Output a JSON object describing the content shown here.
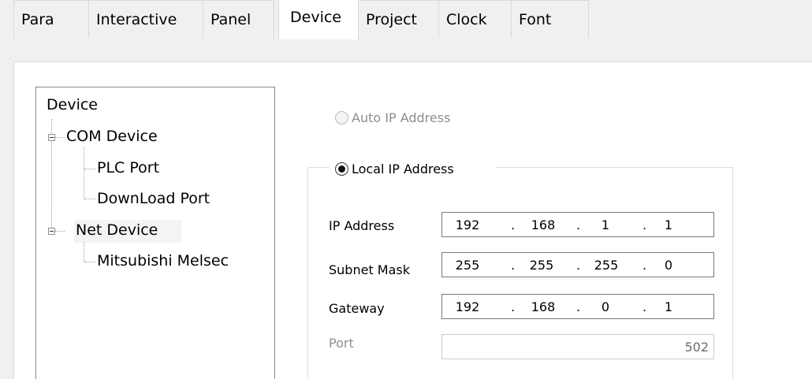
{
  "tabs": [
    {
      "label": "Para"
    },
    {
      "label": "Interactive"
    },
    {
      "label": "Panel"
    },
    {
      "label": "Device"
    },
    {
      "label": "Project"
    },
    {
      "label": "Clock"
    },
    {
      "label": "Font"
    }
  ],
  "active_tab": "Device",
  "tree": {
    "root": "Device",
    "com_device": "COM Device",
    "plc_port": "PLC Port",
    "download_port": "DownLoad Port",
    "net_device": "Net Device",
    "mitsubishi": "Mitsubishi Melsec"
  },
  "network": {
    "auto_ip_label": "Auto IP Address",
    "auto_ip_selected": false,
    "auto_ip_enabled": false,
    "local_ip_label": "Local IP Address",
    "local_ip_selected": true,
    "ip_address": {
      "label": "IP Address",
      "octets": [
        "192",
        "168",
        "1",
        "1"
      ]
    },
    "subnet_mask": {
      "label": "Subnet Mask",
      "octets": [
        "255",
        "255",
        "255",
        "0"
      ]
    },
    "gateway": {
      "label": "Gateway",
      "octets": [
        "192",
        "168",
        "0",
        "1"
      ]
    },
    "port": {
      "label": "Port",
      "value": "502",
      "enabled": false
    },
    "separator": "."
  }
}
